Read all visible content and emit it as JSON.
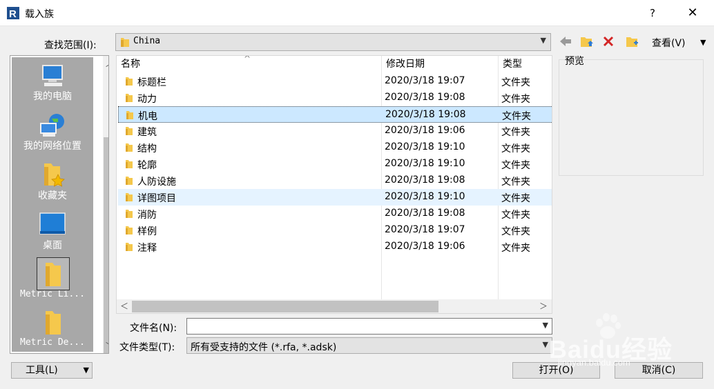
{
  "window": {
    "title": "载入族",
    "help_label": "?",
    "close_label": "✕"
  },
  "lookin": {
    "label": "查找范围(I):",
    "value": "China"
  },
  "toolbar": {
    "view_label": "查看(V)",
    "view_key": "V"
  },
  "places": [
    {
      "label": "我的电脑",
      "icon": "computer-icon"
    },
    {
      "label": "我的网络位置",
      "icon": "network-icon"
    },
    {
      "label": "收藏夹",
      "icon": "favorites-icon"
    },
    {
      "label": "桌面",
      "icon": "desktop-icon"
    },
    {
      "label": "Metric Li...",
      "icon": "folder-icon",
      "selected": true
    },
    {
      "label": "Metric De...",
      "icon": "folder-icon"
    }
  ],
  "file_list": {
    "columns": [
      "名称",
      "修改日期",
      "类型"
    ],
    "rows": [
      {
        "name": "标题栏",
        "date": "2020/3/18 19:07",
        "type": "文件夹"
      },
      {
        "name": "动力",
        "date": "2020/3/18 19:08",
        "type": "文件夹"
      },
      {
        "name": "机电",
        "date": "2020/3/18 19:08",
        "type": "文件夹",
        "selected": true
      },
      {
        "name": "建筑",
        "date": "2020/3/18 19:06",
        "type": "文件夹"
      },
      {
        "name": "结构",
        "date": "2020/3/18 19:10",
        "type": "文件夹"
      },
      {
        "name": "轮廓",
        "date": "2020/3/18 19:10",
        "type": "文件夹"
      },
      {
        "name": "人防设施",
        "date": "2020/3/18 19:08",
        "type": "文件夹"
      },
      {
        "name": "详图项目",
        "date": "2020/3/18 19:10",
        "type": "文件夹",
        "hover": true
      },
      {
        "name": "消防",
        "date": "2020/3/18 19:08",
        "type": "文件夹"
      },
      {
        "name": "样例",
        "date": "2020/3/18 19:07",
        "type": "文件夹"
      },
      {
        "name": "注释",
        "date": "2020/3/18 19:06",
        "type": "文件夹"
      }
    ]
  },
  "preview": {
    "label": "预览"
  },
  "filename": {
    "label": "文件名(N):",
    "value": ""
  },
  "filetype": {
    "label": "文件类型(T):",
    "value": "所有受支持的文件 (*.rfa, *.adsk)"
  },
  "buttons": {
    "tools": "工具(L)",
    "open": "打开(O)",
    "cancel": "取消(C)"
  },
  "watermark": {
    "logo": "Baidu经验",
    "url": "jingyan.baidu.com"
  },
  "colors": {
    "selection": "#cce8ff",
    "hover": "#e5f3ff",
    "places_bg": "#a8a8a8",
    "folder": "#f5c84c"
  }
}
